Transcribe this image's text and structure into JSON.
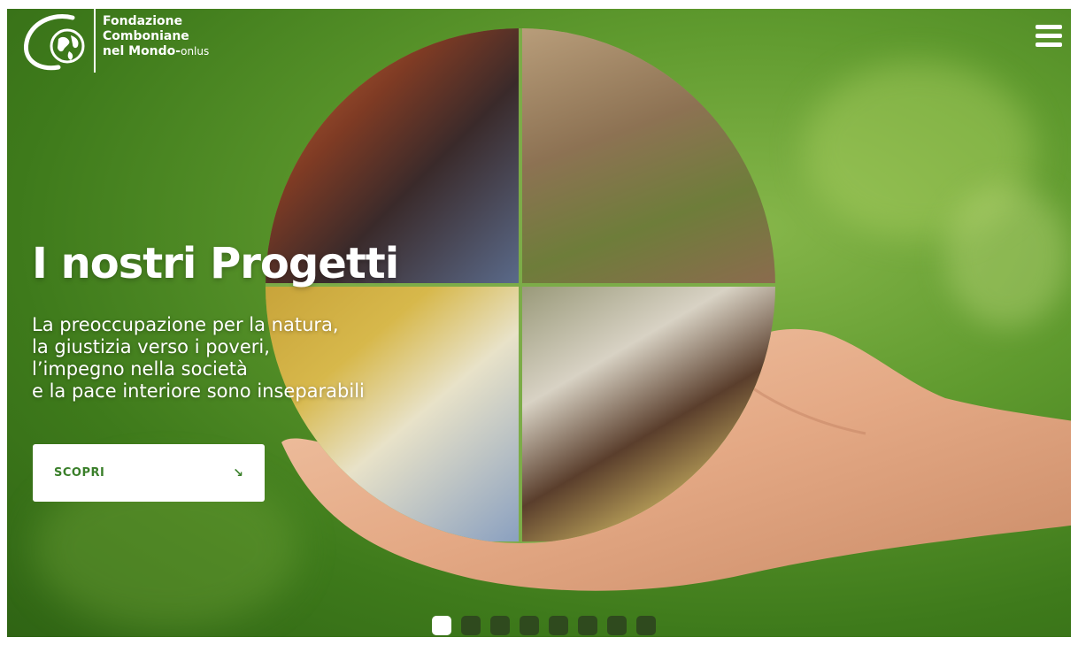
{
  "header": {
    "logo_line1": "Fondazione",
    "logo_line2": "Comboniane",
    "logo_line3_bold": "nel Mondo-",
    "logo_line3_thin": "onlus",
    "menu_icon": "hamburger-menu-icon"
  },
  "hero": {
    "title": "I nostri Progetti",
    "description": [
      "La preoccupazione per la natura,",
      "la giustizia verso i poveri,",
      "l’impegno nella società",
      "e la pace interiore sono inseparabili"
    ],
    "cta_label": "SCOPRI",
    "cta_icon": "arrow-down-right-icon"
  },
  "slider": {
    "total_slides": 8,
    "active_index": 0
  },
  "colors": {
    "accent_green": "#3a7f2a",
    "background_green": "#5f9a2e",
    "dot_inactive": "#2f4a1e",
    "dot_active": "#ffffff"
  }
}
